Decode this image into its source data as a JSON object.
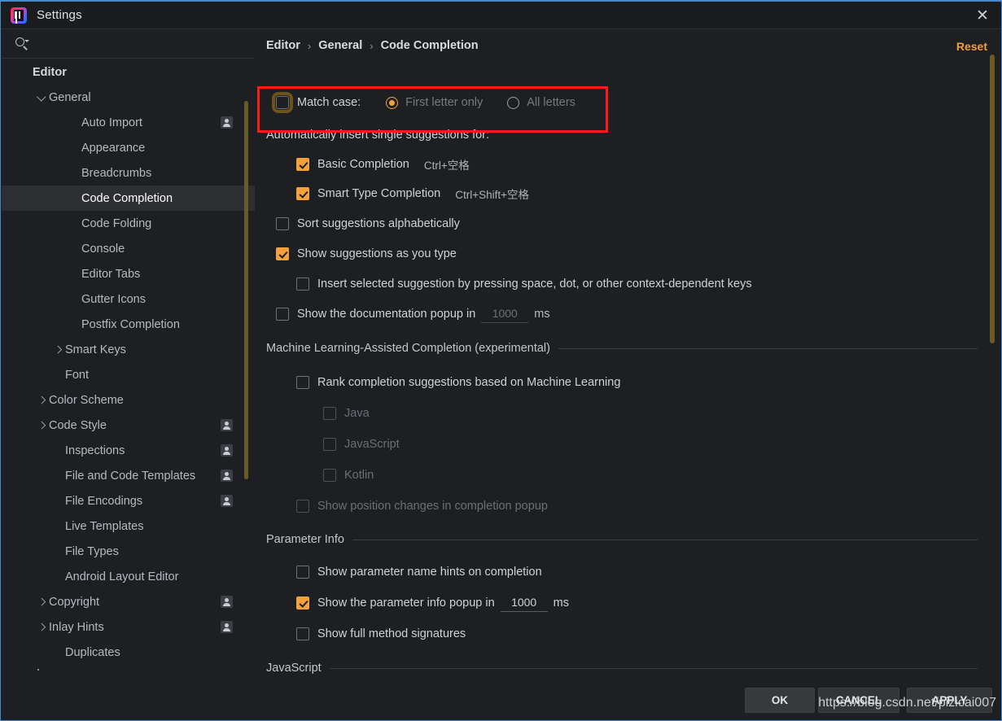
{
  "window": {
    "title": "Settings",
    "logo_icon": "intellij-idea-logo",
    "close_icon": "close-icon"
  },
  "sidebar": {
    "search": {
      "icon": "search-icon",
      "value": "",
      "placeholder": ""
    },
    "scrollbar_color": "#6b5a25",
    "items": [
      {
        "label": "Editor",
        "indent": 0,
        "twisty": "none",
        "group": true,
        "badge": false,
        "selected": false
      },
      {
        "label": "General",
        "indent": 1,
        "twisty": "down",
        "group": false,
        "badge": false,
        "selected": false
      },
      {
        "label": "Auto Import",
        "indent": 3,
        "twisty": "none",
        "group": false,
        "badge": true,
        "selected": false
      },
      {
        "label": "Appearance",
        "indent": 3,
        "twisty": "none",
        "group": false,
        "badge": false,
        "selected": false
      },
      {
        "label": "Breadcrumbs",
        "indent": 3,
        "twisty": "none",
        "group": false,
        "badge": false,
        "selected": false
      },
      {
        "label": "Code Completion",
        "indent": 3,
        "twisty": "none",
        "group": false,
        "badge": false,
        "selected": true
      },
      {
        "label": "Code Folding",
        "indent": 3,
        "twisty": "none",
        "group": false,
        "badge": false,
        "selected": false
      },
      {
        "label": "Console",
        "indent": 3,
        "twisty": "none",
        "group": false,
        "badge": false,
        "selected": false
      },
      {
        "label": "Editor Tabs",
        "indent": 3,
        "twisty": "none",
        "group": false,
        "badge": false,
        "selected": false
      },
      {
        "label": "Gutter Icons",
        "indent": 3,
        "twisty": "none",
        "group": false,
        "badge": false,
        "selected": false
      },
      {
        "label": "Postfix Completion",
        "indent": 3,
        "twisty": "none",
        "group": false,
        "badge": false,
        "selected": false
      },
      {
        "label": "Smart Keys",
        "indent": 2,
        "twisty": "right",
        "group": false,
        "badge": false,
        "selected": false
      },
      {
        "label": "Font",
        "indent": 2,
        "twisty": "none",
        "group": false,
        "badge": false,
        "selected": false
      },
      {
        "label": "Color Scheme",
        "indent": 1,
        "twisty": "right",
        "group": false,
        "badge": false,
        "selected": false
      },
      {
        "label": "Code Style",
        "indent": 1,
        "twisty": "right",
        "group": false,
        "badge": true,
        "selected": false
      },
      {
        "label": "Inspections",
        "indent": 2,
        "twisty": "none",
        "group": false,
        "badge": true,
        "selected": false
      },
      {
        "label": "File and Code Templates",
        "indent": 2,
        "twisty": "none",
        "group": false,
        "badge": true,
        "selected": false
      },
      {
        "label": "File Encodings",
        "indent": 2,
        "twisty": "none",
        "group": false,
        "badge": true,
        "selected": false
      },
      {
        "label": "Live Templates",
        "indent": 2,
        "twisty": "none",
        "group": false,
        "badge": false,
        "selected": false
      },
      {
        "label": "File Types",
        "indent": 2,
        "twisty": "none",
        "group": false,
        "badge": false,
        "selected": false
      },
      {
        "label": "Android Layout Editor",
        "indent": 2,
        "twisty": "none",
        "group": false,
        "badge": false,
        "selected": false
      },
      {
        "label": "Copyright",
        "indent": 1,
        "twisty": "right",
        "group": false,
        "badge": true,
        "selected": false
      },
      {
        "label": "Inlay Hints",
        "indent": 1,
        "twisty": "right",
        "group": false,
        "badge": true,
        "selected": false
      },
      {
        "label": "Duplicates",
        "indent": 2,
        "twisty": "none",
        "group": false,
        "badge": false,
        "selected": false
      }
    ],
    "help_icon": "question-mark-icon",
    "help_color": "#e8415f"
  },
  "main": {
    "breadcrumb": {
      "items": [
        "Editor",
        "General",
        "Code Completion"
      ],
      "separator": "›"
    },
    "reset_label": "Reset",
    "reset_color": "#f0a03a",
    "annotation": {
      "color": "#fc1c17",
      "shape": "rectangle"
    },
    "match_case": {
      "checkbox_label": "Match case:",
      "checked": false,
      "focused": true,
      "options": [
        {
          "label": "First letter only",
          "selected": true,
          "disabled": true
        },
        {
          "label": "All letters",
          "selected": false,
          "disabled": true
        }
      ]
    },
    "auto_insert": {
      "title": "Automatically insert single suggestions for:",
      "items": [
        {
          "label": "Basic Completion",
          "shortcut": "Ctrl+空格",
          "checked": true
        },
        {
          "label": "Smart Type Completion",
          "shortcut": "Ctrl+Shift+空格",
          "checked": true
        }
      ]
    },
    "options": [
      {
        "label": "Sort suggestions alphabetically",
        "checked": false,
        "disabled": false
      },
      {
        "label": "Show suggestions as you type",
        "checked": true,
        "disabled": false
      },
      {
        "label": "Insert selected suggestion by pressing space, dot, or other context-dependent keys",
        "checked": false,
        "disabled": false
      }
    ],
    "doc_popup": {
      "label": "Show the documentation popup in",
      "checked": false,
      "value": "1000",
      "unit": "ms",
      "disabled": true
    },
    "ml_section": {
      "title": "Machine Learning-Assisted Completion (experimental)",
      "rank": {
        "label": "Rank completion suggestions based on Machine Learning",
        "checked": false,
        "disabled": false
      },
      "languages": [
        {
          "label": "Java",
          "checked": false,
          "disabled": true
        },
        {
          "label": "JavaScript",
          "checked": false,
          "disabled": true
        },
        {
          "label": "Kotlin",
          "checked": false,
          "disabled": true
        }
      ],
      "position_changes": {
        "label": "Show position changes in completion popup",
        "checked": false,
        "disabled": true
      }
    },
    "parameter_info": {
      "title": "Parameter Info",
      "items": [
        {
          "label": "Show parameter name hints on completion",
          "checked": false
        },
        {
          "label": "Show full method signatures",
          "checked": false
        }
      ],
      "popup": {
        "label": "Show the parameter info popup in",
        "checked": true,
        "value": "1000",
        "unit": "ms"
      }
    },
    "javascript_section": {
      "title": "JavaScript"
    },
    "scrollbar_color": "#6b5a25"
  },
  "footer": {
    "ok_label": "OK",
    "cancel_label": "CANCEL",
    "apply_label": "APPLY"
  },
  "watermark": {
    "text": "https://blog.csdn.net/pizicai007"
  }
}
